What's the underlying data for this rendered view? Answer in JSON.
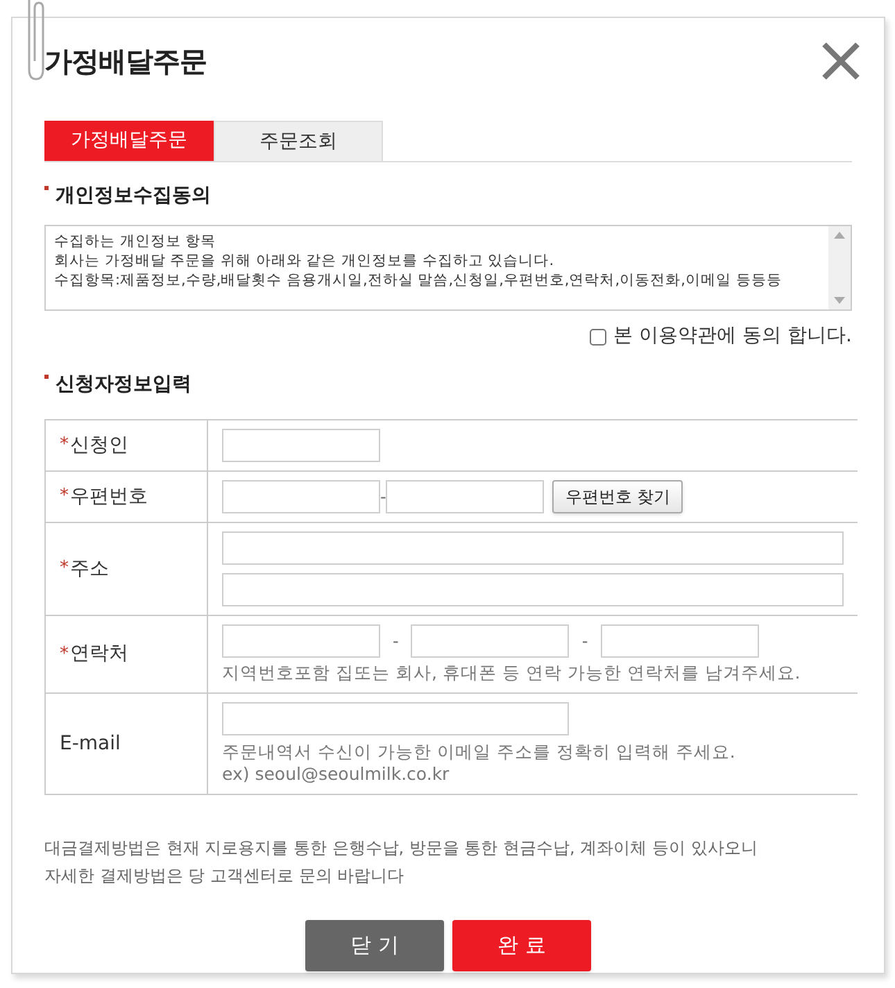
{
  "title": "가정배달주문",
  "tabs": [
    {
      "label": "가정배달주문",
      "selected": true
    },
    {
      "label": "주문조회",
      "selected": false
    }
  ],
  "consent": {
    "heading": "개인정보수집동의",
    "terms": [
      "수집하는 개인정보 항목",
      "회사는 가정배달 주문을 위해 아래와 같은 개인정보를 수집하고 있습니다.",
      "수집항목:제품정보,수량,배달횟수 음용개시일,전하실 말씀,신청일,우편번호,연락처,이동전화,이메일 등등등"
    ],
    "agree": {
      "label": "본 이용약관에 동의 합니다.",
      "checked": false
    }
  },
  "applicant": {
    "heading": "신청자정보입력",
    "rows": [
      {
        "kind": "single",
        "label": "신청인",
        "mark": "*"
      },
      {
        "kind": "postcode",
        "label": "우편번호",
        "mark": "*",
        "separator": "-",
        "button": "우편번호 찾기"
      },
      {
        "kind": "address",
        "label": "주소",
        "mark": "*"
      },
      {
        "kind": "phone",
        "label": "연락처",
        "mark": "*",
        "separator": "-",
        "hints": [
          "지역번호포함 집또는 회사, 휴대폰 등 연락 가능한 연락처를 남겨주세요."
        ]
      },
      {
        "kind": "email",
        "label": "E-mail",
        "hints": [
          "주문내역서 수신이 가능한 이메일 주소를 정확히 입력해 주세요.",
          "ex) seoul@seoulmilk.co.kr"
        ]
      }
    ]
  },
  "notice": [
    "대금결제방법은 현재 지로용지를 통한 은행수납, 방문을 통한 현금수납, 계좌이체 등이 있사오니",
    "자세한 결제방법은 당 고객센터로 문의 바랍니다"
  ],
  "buttons": [
    {
      "kind": "close",
      "label": "닫 기"
    },
    {
      "kind": "submit",
      "label": "완 료"
    }
  ]
}
